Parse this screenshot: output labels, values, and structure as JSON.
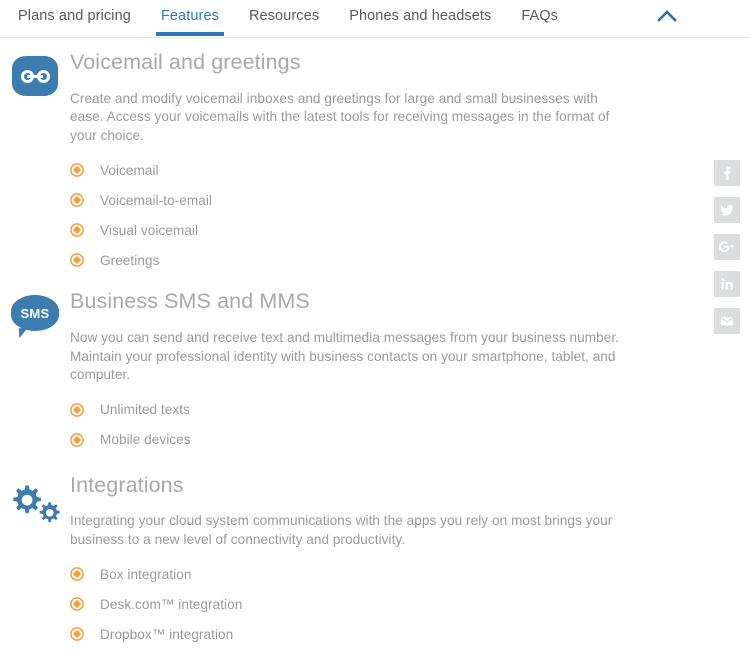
{
  "nav": {
    "items": [
      {
        "label": "Plans and pricing",
        "active": false
      },
      {
        "label": "Features",
        "active": true
      },
      {
        "label": "Resources",
        "active": false
      },
      {
        "label": "Phones and headsets",
        "active": false
      },
      {
        "label": "FAQs",
        "active": false
      }
    ],
    "collapse_icon": "chevron-up-icon",
    "active_color": "#2f7cb8",
    "inactive_color": "#58595b"
  },
  "sections": [
    {
      "icon": "voicemail-icon",
      "title": "Voicemail and greetings",
      "description": "Create and modify voicemail inboxes and greetings for large and small businesses with ease. Access your voicemails with the latest tools for receiving messages in the format of your choice.",
      "features": [
        "Voicemail",
        "Voicemail-to-email",
        "Visual voicemail",
        "Greetings"
      ]
    },
    {
      "icon": "sms-bubble-icon",
      "icon_text": "SMS",
      "title": "Business SMS and MMS",
      "description": "Now you can send and receive text and multimedia messages from your business number. Maintain your professional identity with business contacts on your smartphone, tablet, and computer.",
      "features": [
        "Unlimited texts",
        "Mobile devices"
      ]
    },
    {
      "icon": "gears-icon",
      "title": "Integrations",
      "description": "Integrating your cloud system communications with the apps you rely on most brings your business to a new level of connectivity and productivity.",
      "features": [
        "Box integration",
        "Desk.com™ integration",
        "Dropbox™ integration"
      ]
    }
  ],
  "social_share": {
    "items": [
      {
        "name": "facebook-icon",
        "label": "f"
      },
      {
        "name": "twitter-icon",
        "label": ""
      },
      {
        "name": "googleplus-icon",
        "label": "g+"
      },
      {
        "name": "linkedin-icon",
        "label": "in"
      },
      {
        "name": "email-icon",
        "label": ""
      }
    ],
    "color": "#dcdddf"
  },
  "theme": {
    "brand_blue": "#3d7cae",
    "accent_orange": "#f0a03c",
    "heading_gray": "#a9a9ad",
    "body_gray": "#9a9a9e"
  }
}
